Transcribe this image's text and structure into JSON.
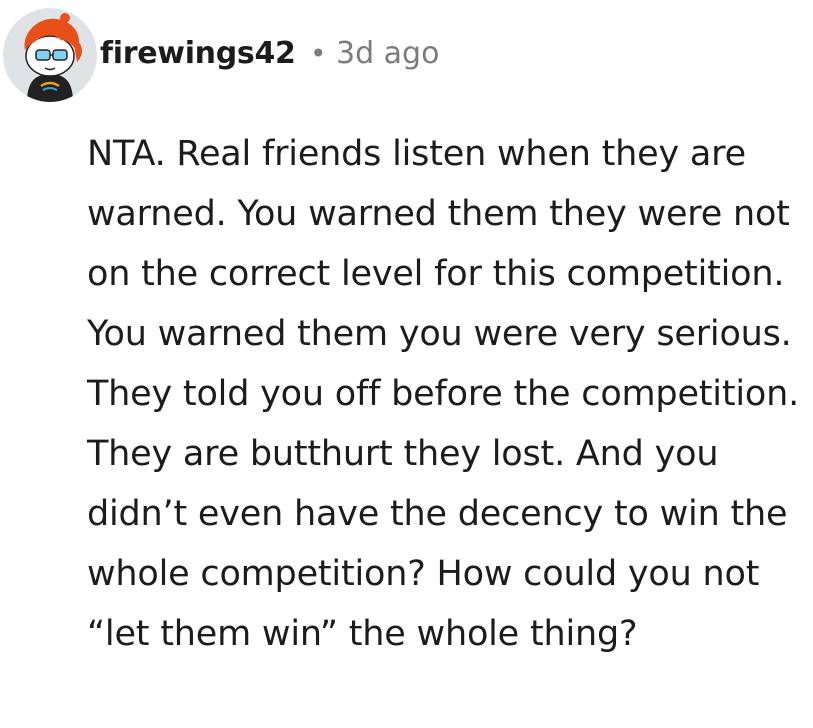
{
  "comment": {
    "author": {
      "username": "firewings42",
      "avatar_icon": "reddit-snoo-avatar-icon"
    },
    "separator": "•",
    "timestamp": "3d ago",
    "body": "NTA. Real friends listen when they are warned. You warned them they were not on the correct level for this competition. You warned them you were very serious. They told you off before the competition. They are butthurt they lost. And you didn’t even have the decency to win the whole competition? How could you not “let them win” the whole thing?"
  },
  "colors": {
    "text": "#1c1c1c",
    "meta": "#7c7c7c",
    "avatar_bg": "#dfe3e6",
    "hair": "#e8501a"
  }
}
